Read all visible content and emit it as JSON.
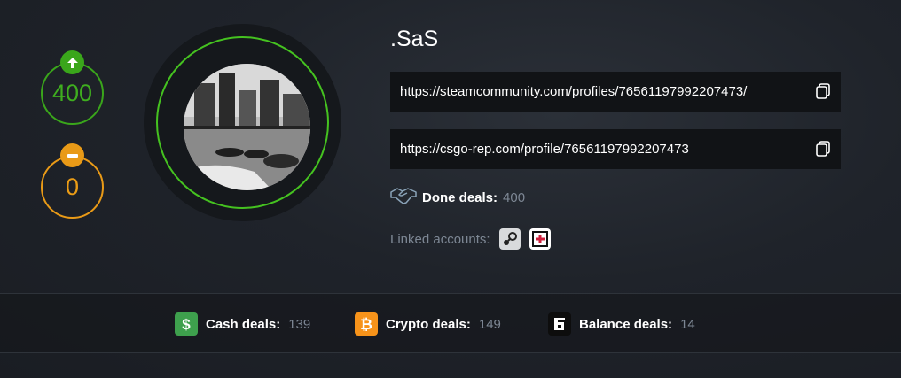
{
  "reputation": {
    "positive": "400",
    "negative": "0",
    "positive_color": "#3aa61b",
    "negative_color": "#e99a17"
  },
  "profile": {
    "username": ".SaS",
    "links": [
      {
        "url": "https://steamcommunity.com/profiles/76561197992207473/",
        "icon": "copy-icon"
      },
      {
        "url": "https://csgo-rep.com/profile/76561197992207473",
        "icon": "copy-icon"
      }
    ],
    "done_deals": {
      "label": "Done deals:",
      "value": "400",
      "icon": "handshake-icon"
    },
    "linked_accounts": {
      "label": "Linked accounts:",
      "accounts": [
        "steam-icon",
        "csgo-rep-icon"
      ]
    }
  },
  "deals": [
    {
      "label": "Cash deals:",
      "value": "139",
      "icon": "dollar-icon",
      "color": "#3ea04d"
    },
    {
      "label": "Crypto deals:",
      "value": "149",
      "icon": "bitcoin-icon",
      "color": "#f7931a"
    },
    {
      "label": "Balance deals:",
      "value": "14",
      "icon": "balance-icon",
      "color": "#0d0d0d"
    }
  ],
  "colors": {
    "accent_green": "#45c220",
    "muted_text": "#7d8794",
    "box_bg": "#111316"
  }
}
